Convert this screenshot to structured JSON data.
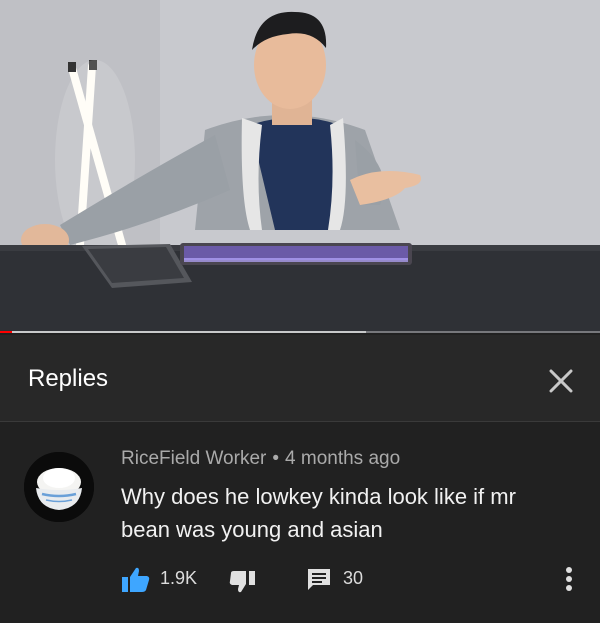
{
  "video": {
    "progress_played": 0.02,
    "progress_buffered": 0.61
  },
  "panel": {
    "title": "Replies",
    "close_icon": "close-icon"
  },
  "comment": {
    "author": "RiceField Worker",
    "separator": "•",
    "time": "4 months ago",
    "text": "Why does he lowkey kinda look like if mr bean was young and asian",
    "avatar_icon": "rice-bowl-avatar",
    "likes": "1.9K",
    "replies": "30",
    "like_icon": "thumbs-up-icon",
    "dislike_icon": "thumbs-down-icon",
    "reply_icon": "comment-icon",
    "more_icon": "more-vert-icon"
  },
  "colors": {
    "background": "#212121",
    "header": "#282828",
    "accent_like": "#3ea6ff",
    "progress": "#ff0000"
  }
}
